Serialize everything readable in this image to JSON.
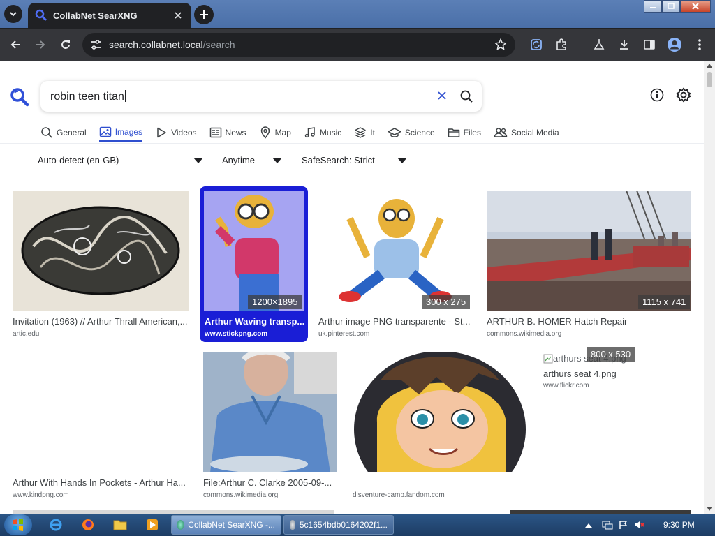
{
  "browser": {
    "tab_title": "CollabNet SearXNG",
    "url_host": "search.collabnet.local",
    "url_path": "/search"
  },
  "search": {
    "query": "robin teen titan"
  },
  "categories": [
    {
      "label": "General",
      "icon": "search-icon",
      "active": false
    },
    {
      "label": "Images",
      "icon": "image-icon",
      "active": true
    },
    {
      "label": "Videos",
      "icon": "play-icon",
      "active": false
    },
    {
      "label": "News",
      "icon": "newspaper-icon",
      "active": false
    },
    {
      "label": "Map",
      "icon": "map-pin-icon",
      "active": false
    },
    {
      "label": "Music",
      "icon": "music-note-icon",
      "active": false
    },
    {
      "label": "It",
      "icon": "layers-icon",
      "active": false
    },
    {
      "label": "Science",
      "icon": "graduation-cap-icon",
      "active": false
    },
    {
      "label": "Files",
      "icon": "folder-icon",
      "active": false
    },
    {
      "label": "Social Media",
      "icon": "people-icon",
      "active": false
    }
  ],
  "filters": {
    "language": "Auto-detect (en-GB)",
    "time": "Anytime",
    "safesearch": "SafeSearch: Strict"
  },
  "results": [
    {
      "title": "Invitation (1963) // Arthur Thrall American,...",
      "site": "artic.edu",
      "dims": ""
    },
    {
      "title": "Arthur Waving transp...",
      "site": "www.stickpng.com",
      "dims": "1200×1895"
    },
    {
      "title": "Arthur image PNG transparente - St...",
      "site": "uk.pinterest.com",
      "dims": "300 x 275"
    },
    {
      "title": "ARTHUR B. HOMER Hatch Repair",
      "site": "commons.wikimedia.org",
      "dims": "1115 x 741"
    },
    {
      "title": "Arthur With Hands In Pockets - Arthur Ha...",
      "site": "www.kindpng.com",
      "dims": ""
    },
    {
      "title": "File:Arthur C. Clarke 2005-09-...",
      "site": "commons.wikimedia.org",
      "dims": ""
    },
    {
      "title": "",
      "site": "disventure-camp.fandom.com",
      "dims": ""
    },
    {
      "title": "arthurs seat 4.png",
      "site": "www.flickr.com",
      "dims": "800 x 530",
      "alt": "arthurs seat 4.png"
    }
  ],
  "taskbar": {
    "tasks": [
      {
        "label": "CollabNet SearXNG -...",
        "active": true
      },
      {
        "label": "5c1654bdb0164202f1...",
        "active": false
      }
    ],
    "clock": "9:30 PM"
  },
  "colors": {
    "accent": "#2f4fcf",
    "selected_card": "#1a1ed6",
    "chrome_dark": "#35363a"
  }
}
